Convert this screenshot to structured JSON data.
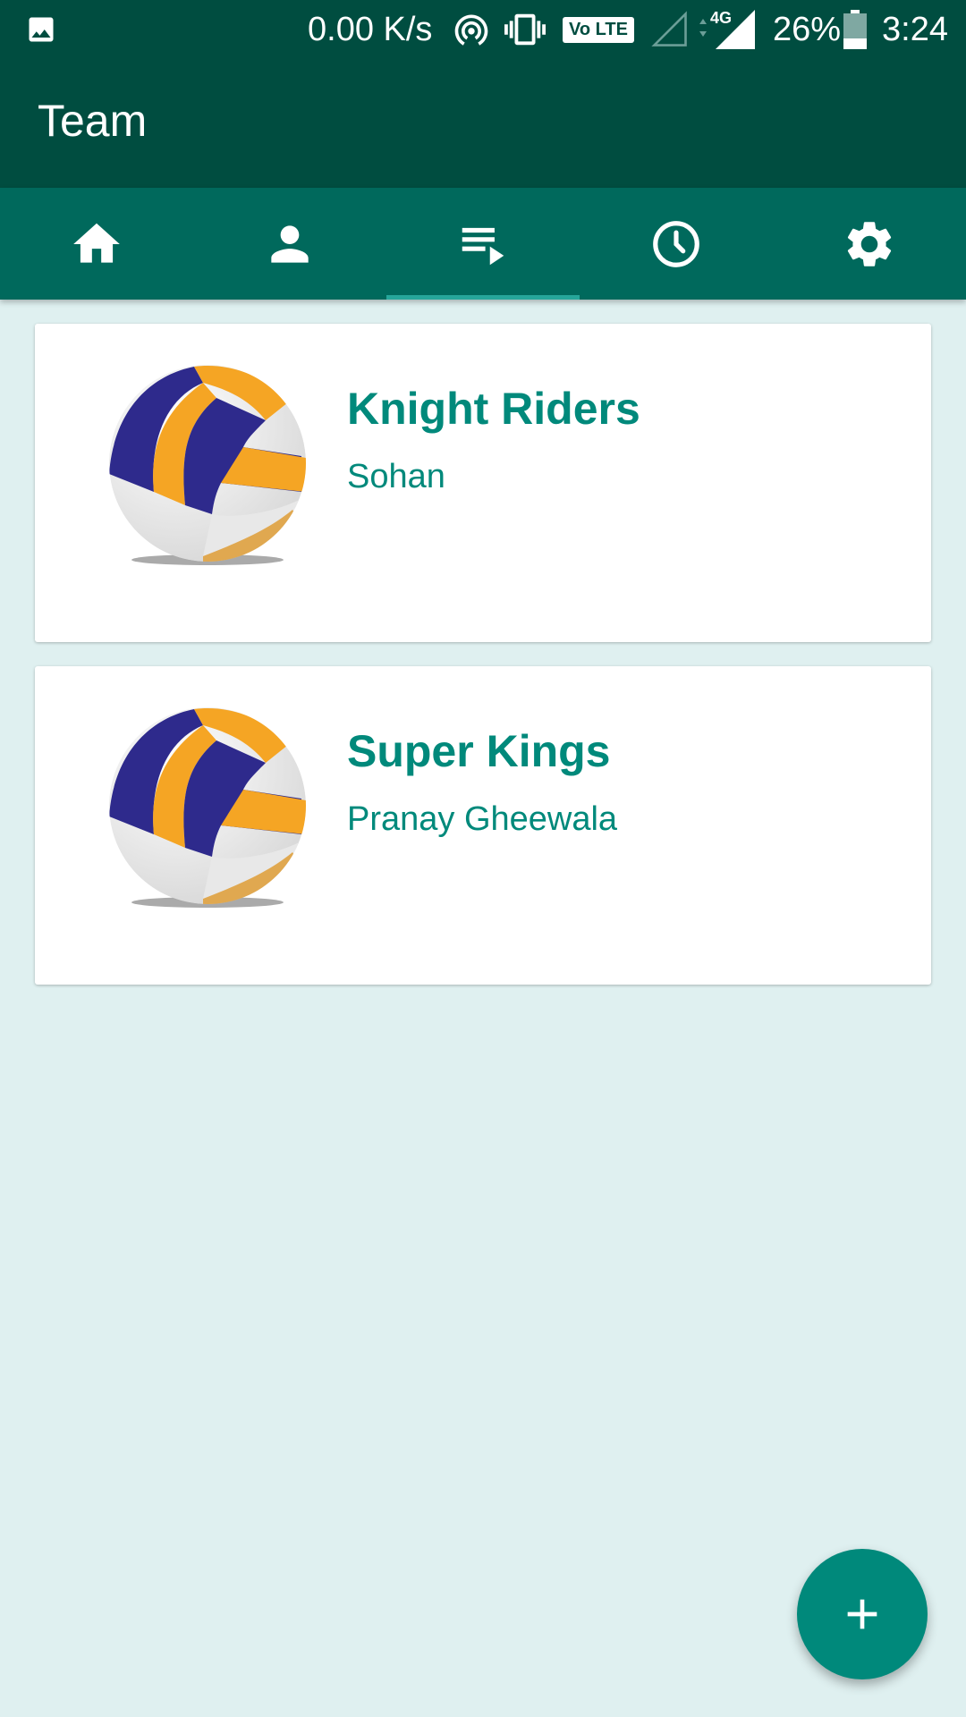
{
  "status_bar": {
    "speed": "0.00 K/s",
    "volte": "Vo LTE",
    "network": "4G",
    "battery": "26%",
    "time": "3:24",
    "icons": [
      "image-icon",
      "hotspot-icon",
      "vibrate-icon",
      "volte-icon",
      "signal-empty-icon",
      "signal-4g-icon",
      "battery-icon"
    ]
  },
  "app_bar": {
    "title": "Team"
  },
  "tabs": [
    {
      "icon": "home-icon",
      "active": false
    },
    {
      "icon": "person-icon",
      "active": false
    },
    {
      "icon": "playlist-icon",
      "active": true
    },
    {
      "icon": "clock-icon",
      "active": false
    },
    {
      "icon": "settings-icon",
      "active": false
    }
  ],
  "teams": [
    {
      "name": "Knight Riders",
      "owner": "Sohan",
      "icon": "volleyball-icon"
    },
    {
      "name": "Super Kings",
      "owner": "Pranay Gheewala",
      "icon": "volleyball-icon"
    }
  ],
  "fab": {
    "icon": "plus-icon"
  },
  "colors": {
    "primary_dark": "#004d40",
    "primary": "#00695c",
    "accent": "#00897b",
    "indicator": "#26a69a",
    "background": "#dff0f0"
  }
}
